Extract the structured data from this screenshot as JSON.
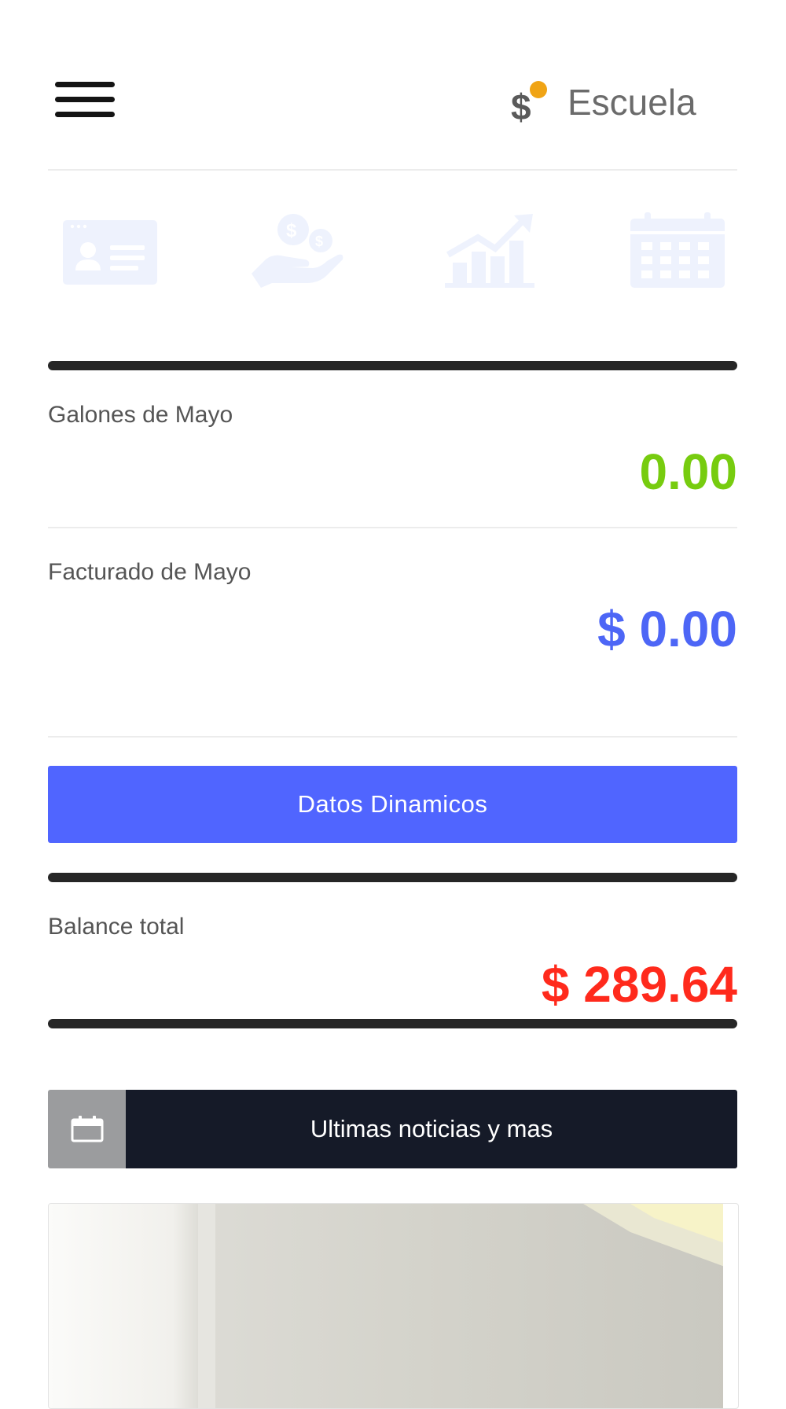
{
  "header": {
    "menu_icon": "hamburger-menu-icon",
    "brand_icon": "dollar-coin-icon",
    "brand_name": "Escuela"
  },
  "quick_actions": [
    {
      "icon": "id-card-icon"
    },
    {
      "icon": "money-hand-icon"
    },
    {
      "icon": "growth-chart-icon"
    },
    {
      "icon": "calendar-grid-icon"
    }
  ],
  "stats": {
    "gallons_label": "Galones de Mayo",
    "gallons_value": "0.00",
    "billed_label": "Facturado de Mayo",
    "billed_value": "$ 0.00",
    "balance_label": "Balance total",
    "balance_value": "$ 289.64"
  },
  "actions": {
    "dynamic_data_label": "Datos Dinamicos"
  },
  "news": {
    "icon": "calendar-icon",
    "label": "Ultimas noticias y mas"
  },
  "colors": {
    "accent_blue": "#5065ff",
    "value_green": "#77cc0f",
    "value_red": "#ff2a1c",
    "icon_faint": "#eef2fd",
    "news_bar_dark": "#151a28"
  }
}
